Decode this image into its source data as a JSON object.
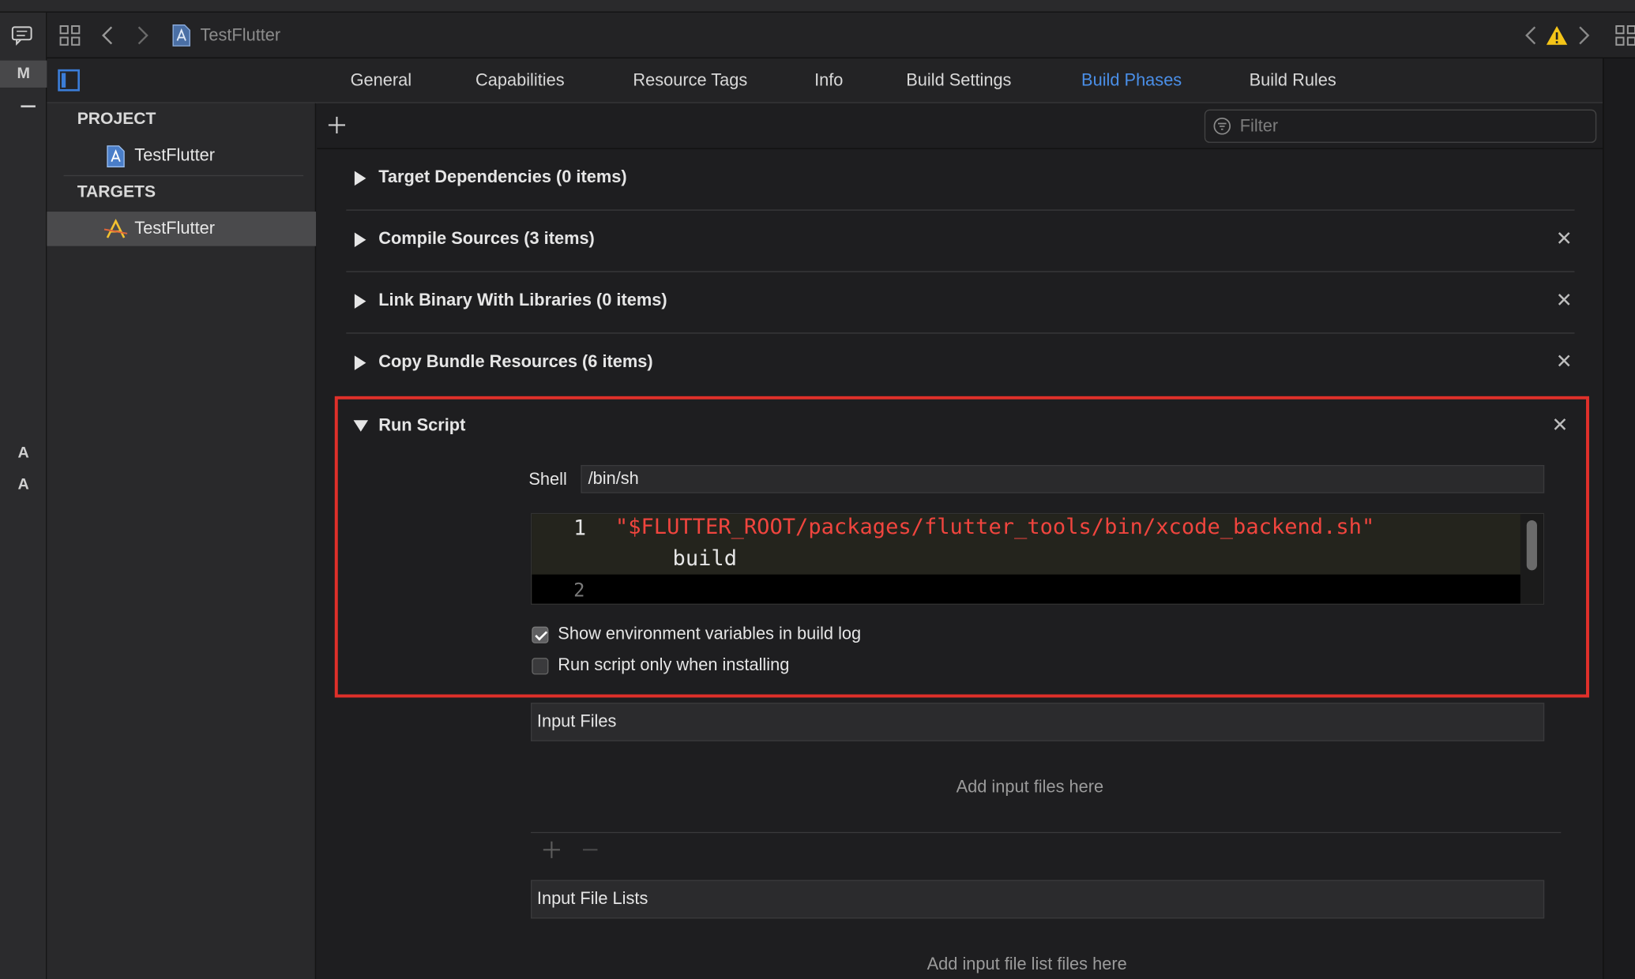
{
  "toolbar": {
    "project_name": "TestFlutter"
  },
  "left_rail": {
    "letters": [
      "M",
      "A",
      "A"
    ]
  },
  "tabs": [
    {
      "label": "General",
      "active": false
    },
    {
      "label": "Capabilities",
      "active": false
    },
    {
      "label": "Resource Tags",
      "active": false
    },
    {
      "label": "Info",
      "active": false
    },
    {
      "label": "Build Settings",
      "active": false
    },
    {
      "label": "Build Phases",
      "active": true
    },
    {
      "label": "Build Rules",
      "active": false
    }
  ],
  "sidebar": {
    "project_header": "PROJECT",
    "project_item": "TestFlutter",
    "targets_header": "TARGETS",
    "target_item": "TestFlutter"
  },
  "filter": {
    "placeholder": "Filter"
  },
  "phases": [
    {
      "title": "Target Dependencies (0 items)",
      "removable": false
    },
    {
      "title": "Compile Sources (3 items)",
      "removable": true
    },
    {
      "title": "Link Binary With Libraries (0 items)",
      "removable": true
    },
    {
      "title": "Copy Bundle Resources (6 items)",
      "removable": true
    }
  ],
  "run_script": {
    "title": "Run Script",
    "shell_label": "Shell",
    "shell_value": "/bin/sh",
    "line1_number": "1",
    "line1_code": "\"$FLUTTER_ROOT/packages/flutter_tools/bin/xcode_backend.sh\"",
    "line1_cont": "build",
    "line2_number": "2",
    "show_env_label": "Show environment variables in build log",
    "show_env_checked": true,
    "install_only_label": "Run script only when installing",
    "install_only_checked": false
  },
  "input_files": {
    "header": "Input Files",
    "empty": "Add input files here"
  },
  "input_file_lists": {
    "header": "Input File Lists",
    "empty": "Add input file list files here"
  },
  "colors": {
    "accent": "#4a8fe8",
    "highlight_border": "#e0302a",
    "code_string": "#f0453e",
    "warning": "#f5c518"
  }
}
